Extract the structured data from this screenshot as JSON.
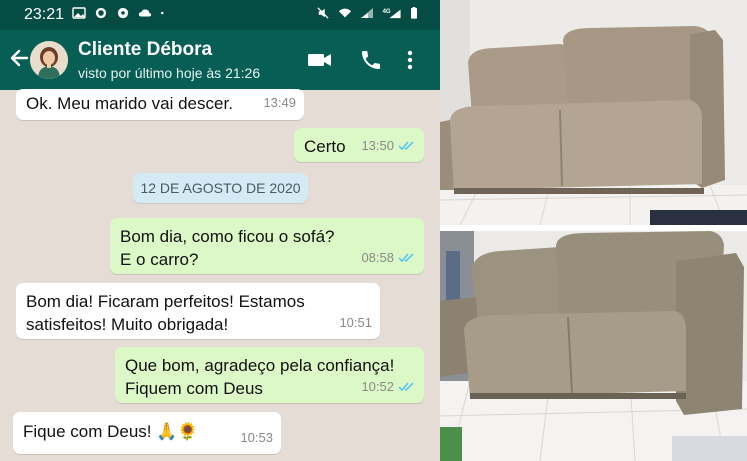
{
  "status_bar": {
    "time": "23:21",
    "left_icons": [
      "image-icon",
      "whatsapp-icon",
      "soccer-ball-icon",
      "cloud-icon",
      "dot-icon"
    ],
    "right_icons": [
      "mute-icon",
      "wifi-icon",
      "signal-icon",
      "4g-signal-icon",
      "battery-icon"
    ],
    "network_label": "4G"
  },
  "header": {
    "contact_name": "Cliente Débora",
    "last_seen": "visto por último hoje às 21:26",
    "icons": [
      "back-arrow-icon",
      "video-call-icon",
      "phone-call-icon",
      "more-vert-icon"
    ],
    "colors": {
      "header": "#075e54",
      "status_bar": "#054d44"
    }
  },
  "chat": {
    "background_color": "#e5ddd5",
    "incoming_color": "#ffffff",
    "outgoing_color": "#dcf8c6",
    "date_separator": "12 DE AGOSTO DE 2020",
    "messages": [
      {
        "direction": "in",
        "text": "Ok. Meu marido vai descer.",
        "time": "13:49",
        "read": false
      },
      {
        "direction": "out",
        "text": "Certo",
        "time": "13:50",
        "read": true
      },
      {
        "direction": "out",
        "text": "Bom dia, como ficou o sofá?\nE o carro?",
        "time": "08:58",
        "read": true
      },
      {
        "direction": "in",
        "text": "Bom dia! Ficaram perfeitos! Estamos\nsatisfeitos! Muito obrigada!",
        "time": "10:51",
        "read": false
      },
      {
        "direction": "out",
        "text": "Que bom, agradeço pela confiança!\nFiquem com Deus",
        "time": "10:52",
        "read": true
      },
      {
        "direction": "in",
        "text": "Fique com Deus! 🙏🌻",
        "time": "10:53",
        "read": false
      }
    ],
    "tick_color": "#4fc3f7"
  },
  "photos": [
    {
      "subject": "sofa-photo-top",
      "sofa_color": "#a99b88"
    },
    {
      "subject": "sofa-photo-bottom",
      "sofa_color": "#9c9280"
    }
  ]
}
